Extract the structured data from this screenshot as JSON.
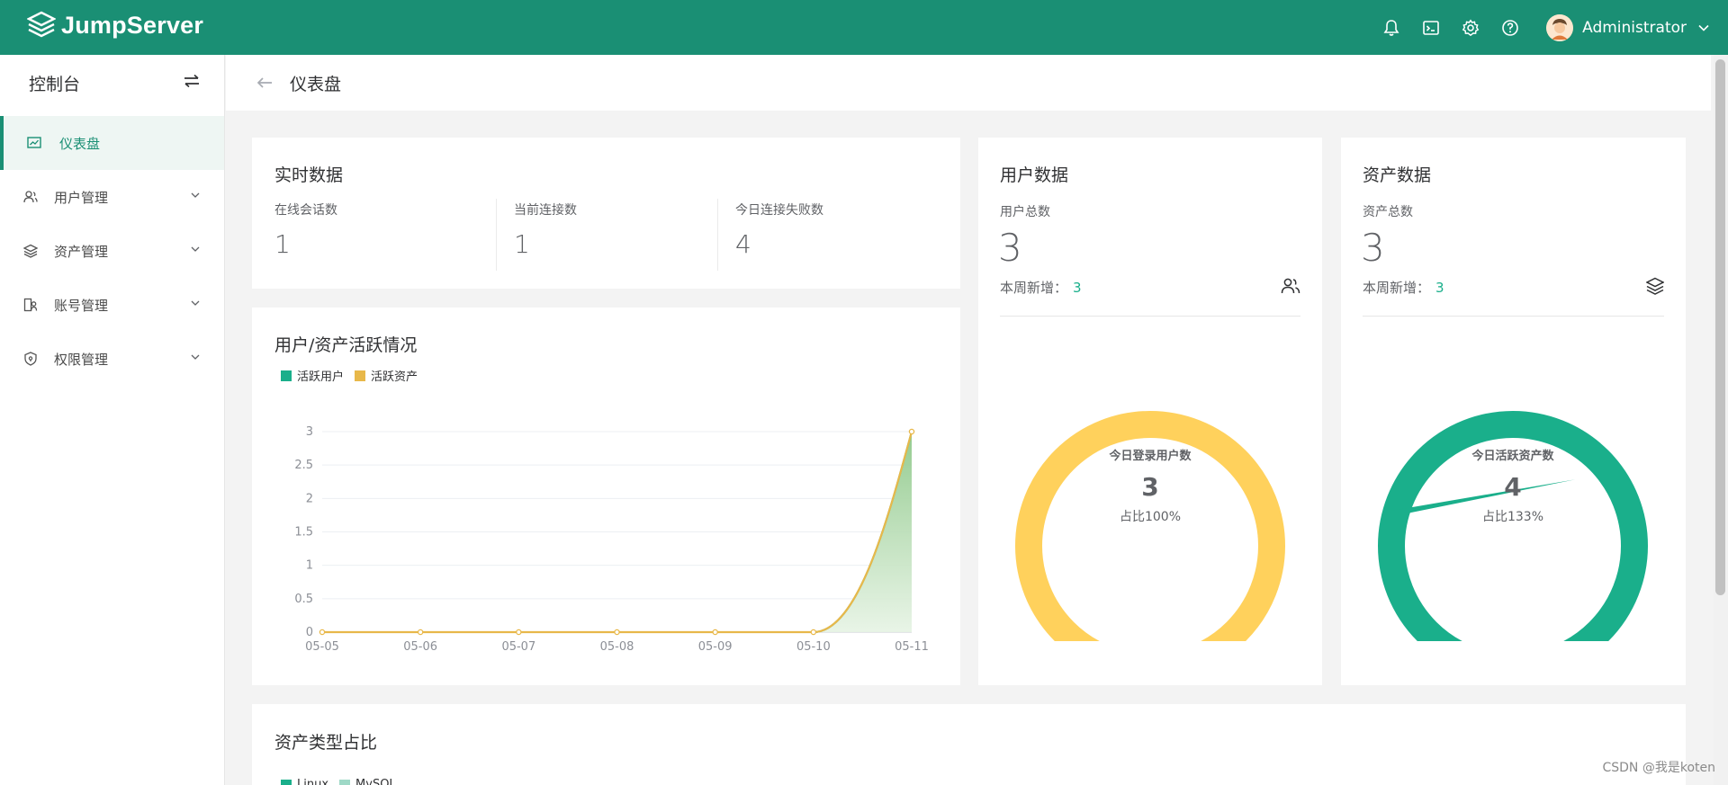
{
  "app": {
    "brand": "JumpServer"
  },
  "header": {
    "username": "Administrator"
  },
  "sidebar": {
    "title": "控制台",
    "items": [
      {
        "label": "仪表盘",
        "active": true
      },
      {
        "label": "用户管理"
      },
      {
        "label": "资产管理"
      },
      {
        "label": "账号管理"
      },
      {
        "label": "权限管理"
      }
    ]
  },
  "page": {
    "title": "仪表盘"
  },
  "realtime": {
    "title": "实时数据",
    "stats": [
      {
        "label": "在线会话数",
        "value": "1"
      },
      {
        "label": "当前连接数",
        "value": "1"
      },
      {
        "label": "今日连接失败数",
        "value": "4"
      }
    ]
  },
  "activity": {
    "title": "用户/资产活跃情况",
    "legend": [
      {
        "label": "活跃用户",
        "color": "#1aaf8b"
      },
      {
        "label": "活跃资产",
        "color": "#e8b84a"
      }
    ]
  },
  "user_data": {
    "title": "用户数据",
    "total_label": "用户总数",
    "total": "3",
    "weekly_label": "本周新增：",
    "weekly_value": "3",
    "donut_label": "今日登录用户数",
    "donut_value": "3",
    "donut_pct": "占比100%",
    "ring_color": "#ffd15c",
    "ring_fraction": 1.0
  },
  "asset_data": {
    "title": "资产数据",
    "total_label": "资产总数",
    "total": "3",
    "weekly_label": "本周新增：",
    "weekly_value": "3",
    "donut_label": "今日活跃资产数",
    "donut_value": "4",
    "donut_pct": "占比133%",
    "ring_color": "#1aaf8b",
    "ring_fraction": 1.33
  },
  "asset_type": {
    "title": "资产类型占比",
    "legend": [
      {
        "label": "Linux",
        "color": "#1aaf8b"
      },
      {
        "label": "MySQL",
        "color": "#9fd9c7"
      }
    ]
  },
  "watermark": "CSDN @我是koten",
  "chart_data": {
    "type": "area",
    "x": [
      "05-05",
      "05-06",
      "05-07",
      "05-08",
      "05-09",
      "05-10",
      "05-11"
    ],
    "yticks": [
      "0",
      "0.5",
      "1",
      "1.5",
      "2",
      "2.5",
      "3"
    ],
    "ylim": [
      0,
      3
    ],
    "series": [
      {
        "name": "活跃用户",
        "values": [
          0,
          0,
          0,
          0,
          0,
          0,
          3
        ],
        "color": "#1aaf8b"
      },
      {
        "name": "活跃资产",
        "values": [
          0,
          0,
          0,
          0,
          0,
          0,
          3
        ],
        "color": "#e8b84a"
      }
    ],
    "grid": true,
    "legend_position": "top-left"
  }
}
